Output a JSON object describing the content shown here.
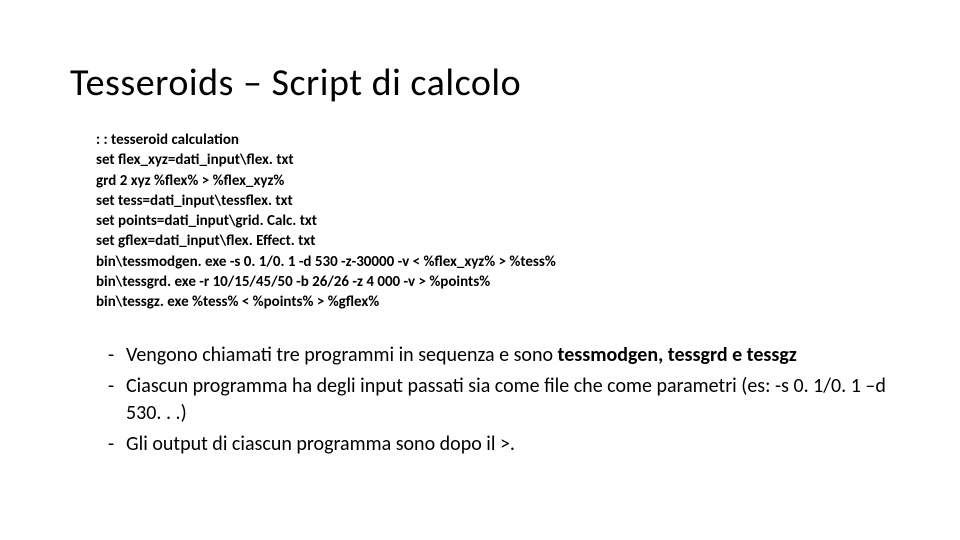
{
  "title": "Tesseroids – Script di calcolo",
  "code": [
    ": : tesseroid calculation",
    "set flex_xyz=dati_input\\flex. txt",
    "grd 2 xyz %flex% > %flex_xyz%",
    "set tess=dati_input\\tessflex. txt",
    "set points=dati_input\\grid. Calc. txt",
    "set gflex=dati_input\\flex. Effect. txt",
    "bin\\tessmodgen. exe -s 0. 1/0. 1 -d 530 -z-30000 -v < %flex_xyz% > %tess%",
    "bin\\tessgrd. exe -r 10/15/45/50 -b 26/26 -z 4 000 -v > %points%",
    "bin\\tessgz. exe %tess% < %points% > %gflex%"
  ],
  "bullets": [
    {
      "pre": "Vengono chiamati tre programmi in sequenza e sono ",
      "bold": "tessmodgen, tessgrd e tessgz",
      "post": ""
    },
    {
      "pre": "Ciascun programma ha degli input passati sia come file che come parametri (es: -s 0. 1/0. 1 –d 530. . .)",
      "bold": "",
      "post": ""
    },
    {
      "pre": "Gli output di ciascun programma sono dopo il >.",
      "bold": "",
      "post": ""
    }
  ]
}
